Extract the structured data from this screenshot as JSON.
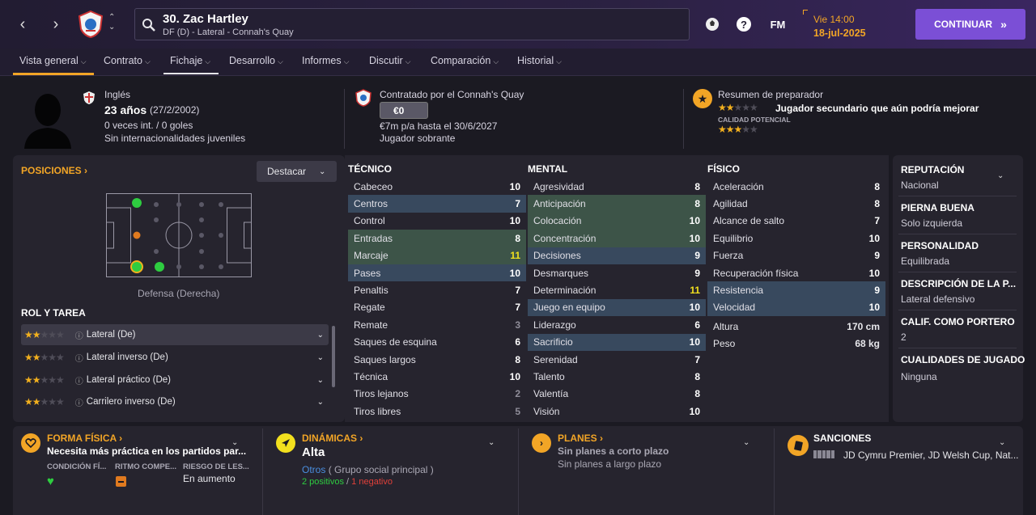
{
  "topbar": {
    "player_title": "30. Zac Hartley",
    "player_sub": "DF (D) - Lateral - Connah's Quay",
    "fm_label": "FM",
    "day_time": "Vie 14:00",
    "date": "18-jul-2025",
    "continue_label": "CONTINUAR"
  },
  "tabs": [
    {
      "label": "Vista general"
    },
    {
      "label": "Contrato"
    },
    {
      "label": "Fichaje"
    },
    {
      "label": "Desarrollo"
    },
    {
      "label": "Informes"
    },
    {
      "label": "Discutir"
    },
    {
      "label": "Comparación"
    },
    {
      "label": "Historial"
    }
  ],
  "header": {
    "nationality": "Inglés",
    "age": "23 años",
    "dob": "(27/2/2002)",
    "caps": "0 veces int. / 0 goles",
    "youth_caps": "Sin internacionalidades juveniles",
    "contracted_by": "Contratado por el Connah's Quay",
    "value": "€0",
    "wage": "€7m p/a hasta el 30/6/2027",
    "squad_status": "Jugador sobrante",
    "coach_summary_title": "Resumen de preparador",
    "coach_summary": "Jugador secundario que aún podría mejorar",
    "potential_label": "CALIDAD POTENCIAL",
    "current_stars": 2,
    "potential_stars": 3
  },
  "positions": {
    "title": "POSICIONES",
    "highlight_label": "Destacar",
    "pitch_caption": "Defensa (Derecha)"
  },
  "roles": {
    "title": "ROL Y TAREA",
    "items": [
      {
        "label": "Lateral (De)",
        "stars": 2
      },
      {
        "label": "Lateral inverso (De)",
        "stars": 2
      },
      {
        "label": "Lateral práctico (De)",
        "stars": 2
      },
      {
        "label": "Carrilero inverso (De)",
        "stars": 2
      }
    ]
  },
  "technical": {
    "title": "TÉCNICO",
    "rows": [
      {
        "name": "Cabeceo",
        "value": "10",
        "hl": ""
      },
      {
        "name": "Centros",
        "value": "7",
        "hl": "blue"
      },
      {
        "name": "Control",
        "value": "10",
        "hl": ""
      },
      {
        "name": "Entradas",
        "value": "8",
        "hl": "green"
      },
      {
        "name": "Marcaje",
        "value": "11",
        "hl": "green"
      },
      {
        "name": "Pases",
        "value": "10",
        "hl": "blue"
      },
      {
        "name": "Penaltis",
        "value": "7",
        "hl": ""
      },
      {
        "name": "Regate",
        "value": "7",
        "hl": ""
      },
      {
        "name": "Remate",
        "value": "3",
        "hl": ""
      },
      {
        "name": "Saques de esquina",
        "value": "6",
        "hl": ""
      },
      {
        "name": "Saques largos",
        "value": "8",
        "hl": ""
      },
      {
        "name": "Técnica",
        "value": "10",
        "hl": ""
      },
      {
        "name": "Tiros lejanos",
        "value": "2",
        "hl": ""
      },
      {
        "name": "Tiros libres",
        "value": "5",
        "hl": ""
      }
    ]
  },
  "mental": {
    "title": "MENTAL",
    "rows": [
      {
        "name": "Agresividad",
        "value": "8",
        "hl": ""
      },
      {
        "name": "Anticipación",
        "value": "8",
        "hl": "green"
      },
      {
        "name": "Colocación",
        "value": "10",
        "hl": "green"
      },
      {
        "name": "Concentración",
        "value": "10",
        "hl": "green"
      },
      {
        "name": "Decisiones",
        "value": "9",
        "hl": "blue"
      },
      {
        "name": "Desmarques",
        "value": "9",
        "hl": ""
      },
      {
        "name": "Determinación",
        "value": "11",
        "hl": ""
      },
      {
        "name": "Juego en equipo",
        "value": "10",
        "hl": "blue"
      },
      {
        "name": "Liderazgo",
        "value": "6",
        "hl": ""
      },
      {
        "name": "Sacrificio",
        "value": "10",
        "hl": "blue"
      },
      {
        "name": "Serenidad",
        "value": "7",
        "hl": ""
      },
      {
        "name": "Talento",
        "value": "8",
        "hl": ""
      },
      {
        "name": "Valentía",
        "value": "8",
        "hl": ""
      },
      {
        "name": "Visión",
        "value": "10",
        "hl": ""
      }
    ]
  },
  "physical": {
    "title": "FÍSICO",
    "rows": [
      {
        "name": "Aceleración",
        "value": "8",
        "hl": ""
      },
      {
        "name": "Agilidad",
        "value": "8",
        "hl": ""
      },
      {
        "name": "Alcance de salto",
        "value": "7",
        "hl": ""
      },
      {
        "name": "Equilibrio",
        "value": "10",
        "hl": ""
      },
      {
        "name": "Fuerza",
        "value": "9",
        "hl": ""
      },
      {
        "name": "Recuperación física",
        "value": "10",
        "hl": ""
      },
      {
        "name": "Resistencia",
        "value": "9",
        "hl": "blue"
      },
      {
        "name": "Velocidad",
        "value": "10",
        "hl": "blue"
      }
    ],
    "height_label": "Altura",
    "height": "170 cm",
    "weight_label": "Peso",
    "weight": "68 kg"
  },
  "info": {
    "reputation_title": "REPUTACIÓN",
    "reputation": "Nacional",
    "foot_title": "PIERNA BUENA",
    "foot": "Solo izquierda",
    "personality_title": "PERSONALIDAD",
    "personality": "Equilibrada",
    "description_title": "DESCRIPCIÓN DE LA P...",
    "description": "Lateral defensivo",
    "gk_title": "CALIF. COMO PORTERO",
    "gk": "2",
    "qualities_title": "CUALIDADES DE JUGADO",
    "qualities": "Ninguna"
  },
  "fitness": {
    "title": "FORMA FÍSICA",
    "text": "Necesita más práctica en los partidos par...",
    "col1": "CONDICIÓN FÍ...",
    "col2": "RITMO COMPE...",
    "col3": "RIESGO DE LES...",
    "col3_value": "En aumento"
  },
  "dynamics": {
    "title": "DINÁMICAS",
    "value": "Alta",
    "group": "Otros",
    "group_suffix": "( Grupo social principal )",
    "positives": "2 positivos",
    "separator": "/",
    "negatives": "1 negativo"
  },
  "plans": {
    "title": "PLANES",
    "short": "Sin planes a corto plazo",
    "long": "Sin planes a largo plazo"
  },
  "sanctions": {
    "title": "SANCIONES",
    "text": "JD Cymru Premier, JD Welsh Cup, Nat..."
  },
  "colors": {
    "accent": "#f2a526",
    "purple": "#7b4fd6",
    "green_dot": "#2ecc40",
    "orange_dot": "#e07a1f"
  }
}
